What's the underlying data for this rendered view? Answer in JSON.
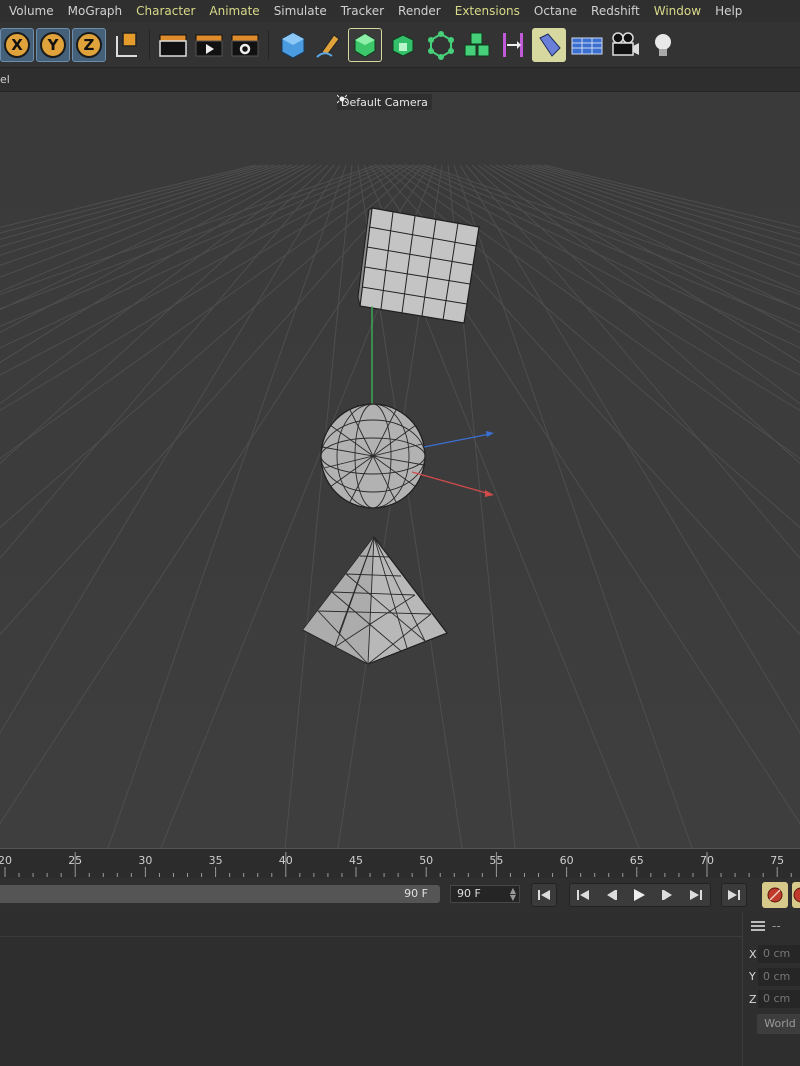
{
  "menu": {
    "items": [
      {
        "label": "Volume",
        "plugin": false
      },
      {
        "label": "MoGraph",
        "plugin": false
      },
      {
        "label": "Character",
        "plugin": true
      },
      {
        "label": "Animate",
        "plugin": true
      },
      {
        "label": "Simulate",
        "plugin": false
      },
      {
        "label": "Tracker",
        "plugin": false
      },
      {
        "label": "Render",
        "plugin": false
      },
      {
        "label": "Extensions",
        "plugin": true
      },
      {
        "label": "Octane",
        "plugin": false
      },
      {
        "label": "Redshift",
        "plugin": false
      },
      {
        "label": "Window",
        "plugin": true
      },
      {
        "label": "Help",
        "plugin": false
      }
    ]
  },
  "toolbar": {
    "axis_x": "X",
    "axis_y": "Y",
    "axis_z": "Z"
  },
  "viewport": {
    "panel_label_clipped": "el",
    "camera_label": "Default Camera",
    "camera_icon": "camera-target-icon"
  },
  "timeline": {
    "ruler_labels": [
      "20",
      "25",
      "30",
      "35",
      "40",
      "45",
      "50",
      "55",
      "60",
      "65",
      "70",
      "75"
    ],
    "slider_value": "90 F",
    "end_frame": "90 F"
  },
  "coordinates": {
    "menu_icon": "hamburger-menu-icon",
    "header_dash": "--",
    "x_label": "X",
    "x_value": "0 cm",
    "y_label": "Y",
    "y_value": "0 cm",
    "z_label": "Z",
    "z_value": "0 cm",
    "space": "World"
  },
  "colors": {
    "plugin_menu": "#d9d98a",
    "axis_x": "#d14b4b",
    "axis_y": "#3fbf5f",
    "axis_z": "#3a6fd1",
    "active_tool": "#45617a"
  }
}
